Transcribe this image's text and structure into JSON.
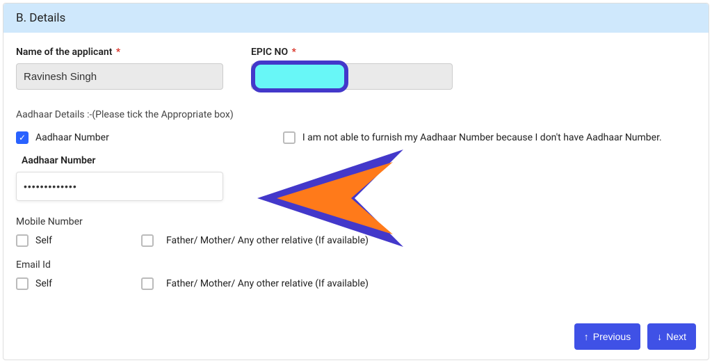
{
  "header": {
    "title": "B. Details"
  },
  "fields": {
    "name_label": "Name of the applicant",
    "name_value": "Ravinesh Singh",
    "epic_label": "EPIC NO",
    "epic_value": ""
  },
  "aadhaar": {
    "section_note": "Aadhaar Details :-(Please tick the Appropriate box)",
    "checkbox_has_label": "Aadhaar Number",
    "checkbox_nohave_label": "I am not able to furnish my Aadhaar Number because I don't have Aadhaar Number.",
    "field_label": "Aadhaar Number",
    "field_value": "•••••••••••••"
  },
  "mobile": {
    "label": "Mobile Number",
    "self": "Self",
    "relative": "Father/ Mother/ Any other relative (If available)"
  },
  "email": {
    "label": "Email Id",
    "self": "Self",
    "relative": "Father/ Mother/ Any other relative (If available)"
  },
  "buttons": {
    "previous": "Previous",
    "next": "Next"
  }
}
